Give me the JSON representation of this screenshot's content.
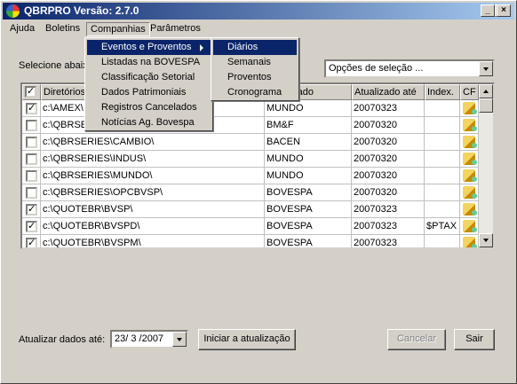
{
  "window": {
    "title": "QBRPRO Versão: 2.7.0"
  },
  "title_buttons": {
    "minimize": "_",
    "maximize": "□",
    "close": "×"
  },
  "menubar": {
    "items": [
      "Ajuda",
      "Boletins",
      "Companhias",
      "Parâmetros"
    ]
  },
  "companhias_menu": {
    "items": [
      "Eventos e Proventos",
      "Listadas na BOVESPA",
      "Classificação Setorial",
      "Dados Patrimoniais",
      "Registros Cancelados",
      "Notícias Ag. Bovespa"
    ]
  },
  "eventos_submenu": {
    "items": [
      "Diários",
      "Semanais",
      "Proventos",
      "Cronograma"
    ]
  },
  "main": {
    "select_label": "Selecione abaixo",
    "options_combo": "Opções de seleção ..."
  },
  "grid": {
    "headers": [
      "Diretórios",
      "Mercado",
      "Atualizado até",
      "Index.",
      "CF"
    ],
    "mercado_header_visible": "a Mercado",
    "rows": [
      {
        "checked": true,
        "dir": "c:\\AMEX\\",
        "mercado": "MUNDO",
        "atualizado": "20070323",
        "index": ""
      },
      {
        "checked": false,
        "dir": "c:\\QBRSERIES\\BMF\\",
        "mercado": "BM&F",
        "atualizado": "20070320",
        "index": ""
      },
      {
        "checked": false,
        "dir": "c:\\QBRSERIES\\CAMBIO\\",
        "mercado": "BACEN",
        "atualizado": "20070320",
        "index": ""
      },
      {
        "checked": false,
        "dir": "c:\\QBRSERIES\\INDUS\\",
        "mercado": "MUNDO",
        "atualizado": "20070320",
        "index": ""
      },
      {
        "checked": false,
        "dir": "c:\\QBRSERIES\\MUNDO\\",
        "mercado": "MUNDO",
        "atualizado": "20070320",
        "index": ""
      },
      {
        "checked": false,
        "dir": "c:\\QBRSERIES\\OPCBVSP\\",
        "mercado": "BOVESPA",
        "atualizado": "20070320",
        "index": ""
      },
      {
        "checked": true,
        "dir": "c:\\QUOTEBR\\BVSP\\",
        "mercado": "BOVESPA",
        "atualizado": "20070323",
        "index": ""
      },
      {
        "checked": true,
        "dir": "c:\\QUOTEBR\\BVSPD\\",
        "mercado": "BOVESPA",
        "atualizado": "20070323",
        "index": "$PTAX"
      },
      {
        "checked": true,
        "dir": "c:\\QUOTEBR\\BVSPM\\",
        "mercado": "BOVESPA",
        "atualizado": "20070323",
        "index": ""
      }
    ]
  },
  "footer": {
    "update_label": "Atualizar dados até:",
    "date_value": "23/ 3 /2007",
    "start_button": "Iniciar a atualização",
    "cancel_button": "Cancelar",
    "exit_button": "Sair"
  }
}
